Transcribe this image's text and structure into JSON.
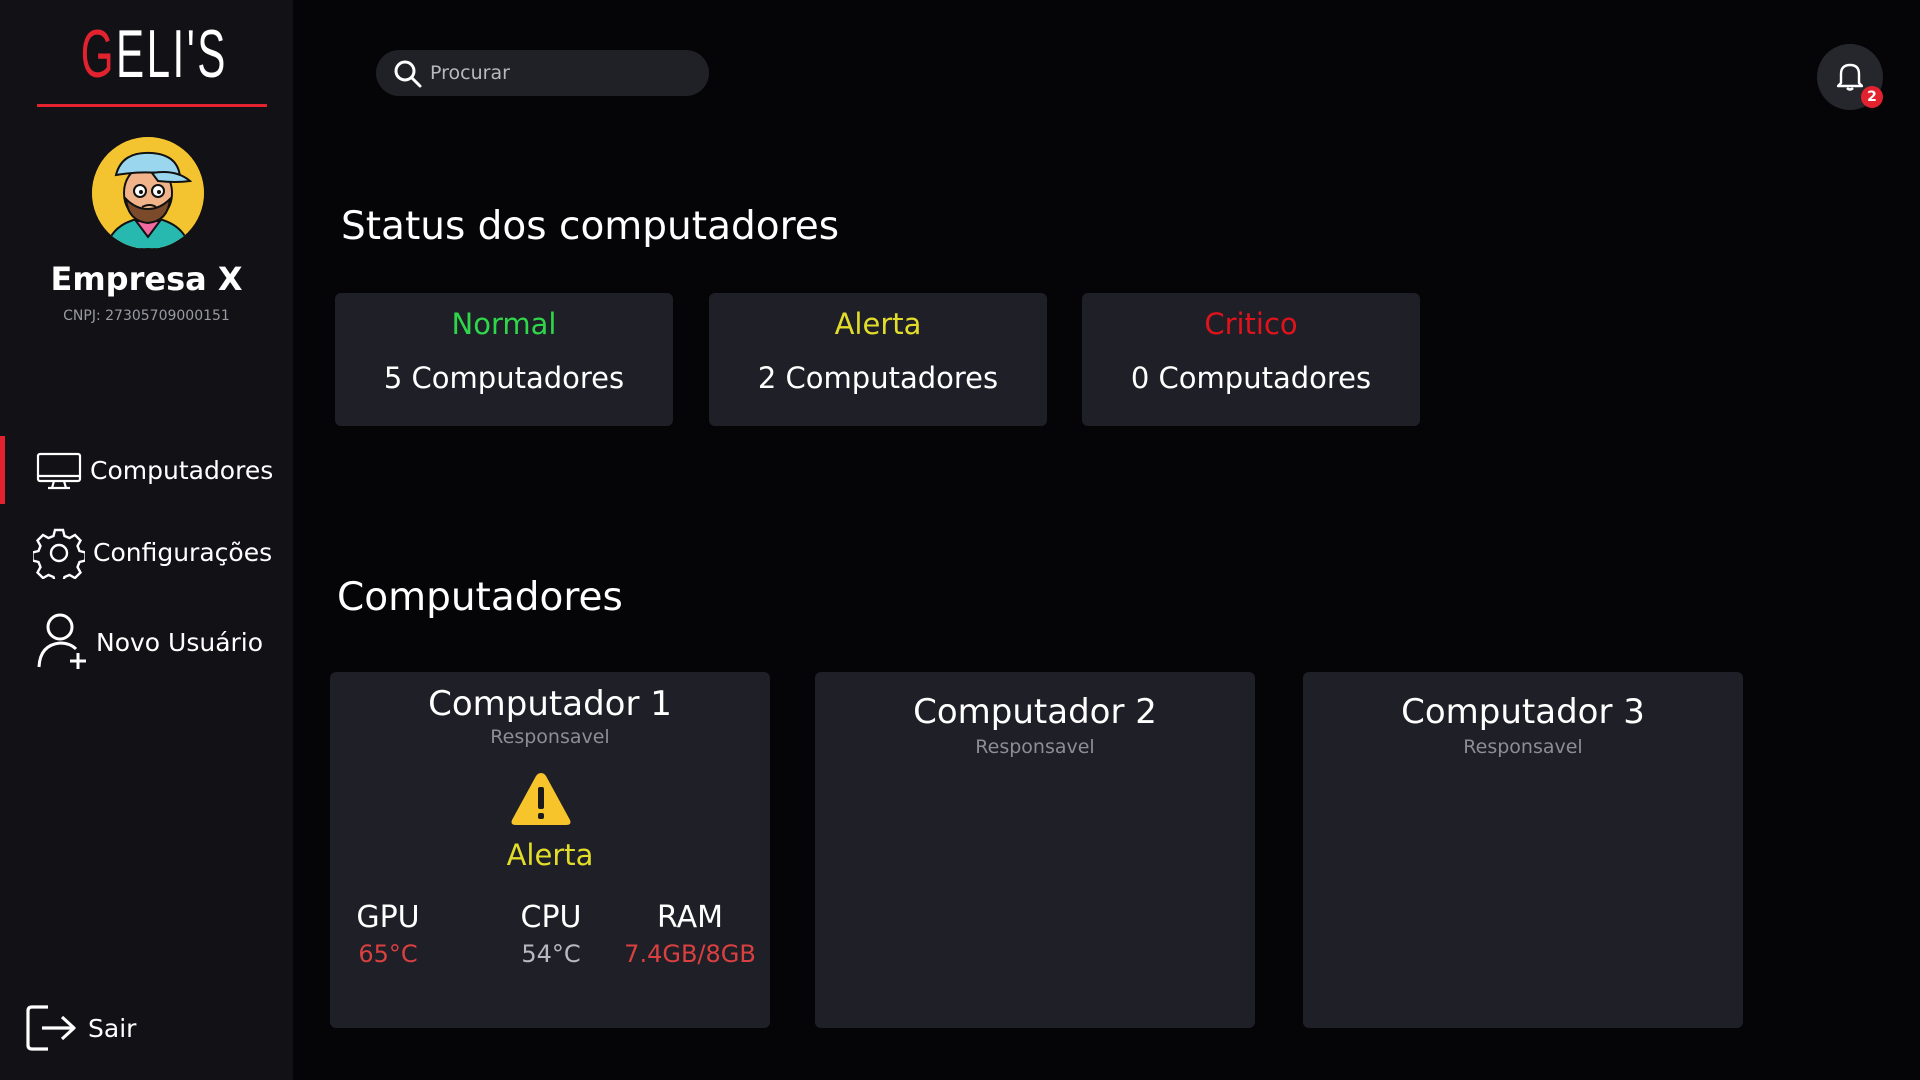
{
  "brand": {
    "logo_prefix": "G",
    "logo_rest": "ELI'S",
    "accent_color": "#e2232f"
  },
  "company": {
    "name": "Empresa X",
    "cnpj": "CNPJ: 27305709000151"
  },
  "sidebar": {
    "items": [
      {
        "label": "Computadores",
        "icon": "monitor-icon",
        "active": true
      },
      {
        "label": "Configurações",
        "icon": "gear-icon",
        "active": false
      },
      {
        "label": "Novo Usuário",
        "icon": "add-user-icon",
        "active": false
      }
    ],
    "logout_label": "Sair"
  },
  "search": {
    "placeholder": "Procurar",
    "value": ""
  },
  "notifications": {
    "count": "2"
  },
  "status_section": {
    "title": "Status dos computadores",
    "cards": [
      {
        "label": "Normal",
        "count_text": "5 Computadores",
        "color": "#2fd64a"
      },
      {
        "label": "Alerta",
        "count_text": "2 Computadores",
        "color": "#e2dc2a"
      },
      {
        "label": "Critico",
        "count_text": "0 Computadores",
        "color": "#e0131c"
      }
    ]
  },
  "computers_section": {
    "title": "Computadores",
    "cards": [
      {
        "title": "Computador 1",
        "subtitle": "Responsavel",
        "status": "Alerta",
        "status_icon": "warning-icon",
        "metrics": [
          {
            "label": "GPU",
            "value": "65°C",
            "color": "#d94040"
          },
          {
            "label": "CPU",
            "value": "54°C",
            "color": "#b8b8c0"
          },
          {
            "label": "RAM",
            "value": "7.4GB/8GB",
            "color": "#d94040"
          }
        ]
      },
      {
        "title": "Computador 2",
        "subtitle": "Responsavel"
      },
      {
        "title": "Computador 3",
        "subtitle": "Responsavel"
      }
    ]
  }
}
